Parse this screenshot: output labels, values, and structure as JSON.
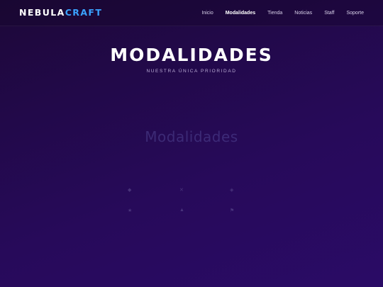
{
  "header": {
    "logo": {
      "part1": "NEBULA",
      "part2": "CRAFT"
    },
    "nav": [
      {
        "label": "Inicio",
        "active": false
      },
      {
        "label": "Modalidades",
        "active": true
      },
      {
        "label": "Tienda",
        "active": false
      },
      {
        "label": "Noticias",
        "active": false
      },
      {
        "label": "Staff",
        "active": false
      },
      {
        "label": "Soporte",
        "active": false
      }
    ]
  },
  "hero": {
    "title": "MODALIDADES",
    "subtitle": "NUESTRA ÚNICA PRIORIDAD"
  },
  "section": {
    "label": "",
    "title": "Modalidades",
    "description": "",
    "modes": [
      {
        "icon": "cube-icon",
        "label": ""
      },
      {
        "icon": "sword-icon",
        "label": ""
      },
      {
        "icon": "shield-icon",
        "label": ""
      },
      {
        "icon": "star-icon",
        "label": ""
      },
      {
        "icon": "tree-icon",
        "label": ""
      },
      {
        "icon": "flag-icon",
        "label": ""
      }
    ]
  },
  "colors": {
    "accent": "#3aa2ff",
    "background_start": "#1d0838",
    "background_end": "#2a0b66"
  }
}
